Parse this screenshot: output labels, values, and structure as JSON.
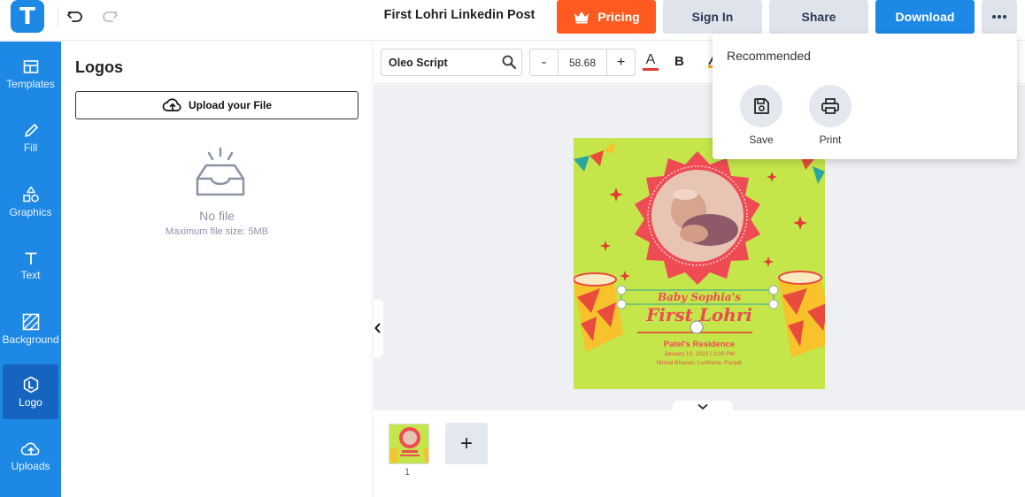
{
  "topbar": {
    "logo_letter": "T",
    "undo_icon": "undo-icon",
    "redo_icon": "redo-icon",
    "doc_title": "First Lohri Linkedin Post",
    "pricing_label": "Pricing",
    "signin_label": "Sign In",
    "share_label": "Share",
    "download_label": "Download",
    "more_icon": "more-dots-icon"
  },
  "sidebar": {
    "items": [
      {
        "label": "Templates",
        "icon": "templates-icon"
      },
      {
        "label": "Fill",
        "icon": "pencil-icon"
      },
      {
        "label": "Graphics",
        "icon": "shapes-icon"
      },
      {
        "label": "Text",
        "icon": "text-icon"
      },
      {
        "label": "Background",
        "icon": "background-icon"
      },
      {
        "label": "Logo",
        "icon": "logo-icon",
        "active": true
      },
      {
        "label": "Uploads",
        "icon": "cloud-upload-icon"
      }
    ]
  },
  "panel": {
    "title": "Logos",
    "upload_label": "Upload your File",
    "empty_text": "No file",
    "max_size_text": "Maximum file size: 5MB"
  },
  "format_toolbar": {
    "font_name": "Oleo Script",
    "font_size": "58.68",
    "minus_label": "-",
    "plus_label": "+",
    "color_letter": "A",
    "bold_label": "B",
    "text_color": "#e53935"
  },
  "poster": {
    "name_line": "Baby Sophia's",
    "title_line": "First Lohri",
    "residence": "Patel's Residence",
    "date_line": "January 13, 2022 | 2:00 PM",
    "place_line": "Nirmal Bhavan, Ludhiana, Punjab",
    "background_color": "#c4e64a",
    "accent_color": "#ef4b55"
  },
  "pages": {
    "items": [
      {
        "number": "1"
      }
    ],
    "add_label": "+"
  },
  "dropdown": {
    "title": "Recommended",
    "items": [
      {
        "label": "Save",
        "icon": "save-icon"
      },
      {
        "label": "Print",
        "icon": "print-icon"
      }
    ]
  },
  "colors": {
    "brand_blue": "#1e88e5",
    "pricing_orange": "#ff5a1f",
    "secondary_button": "#dfe3ea"
  }
}
